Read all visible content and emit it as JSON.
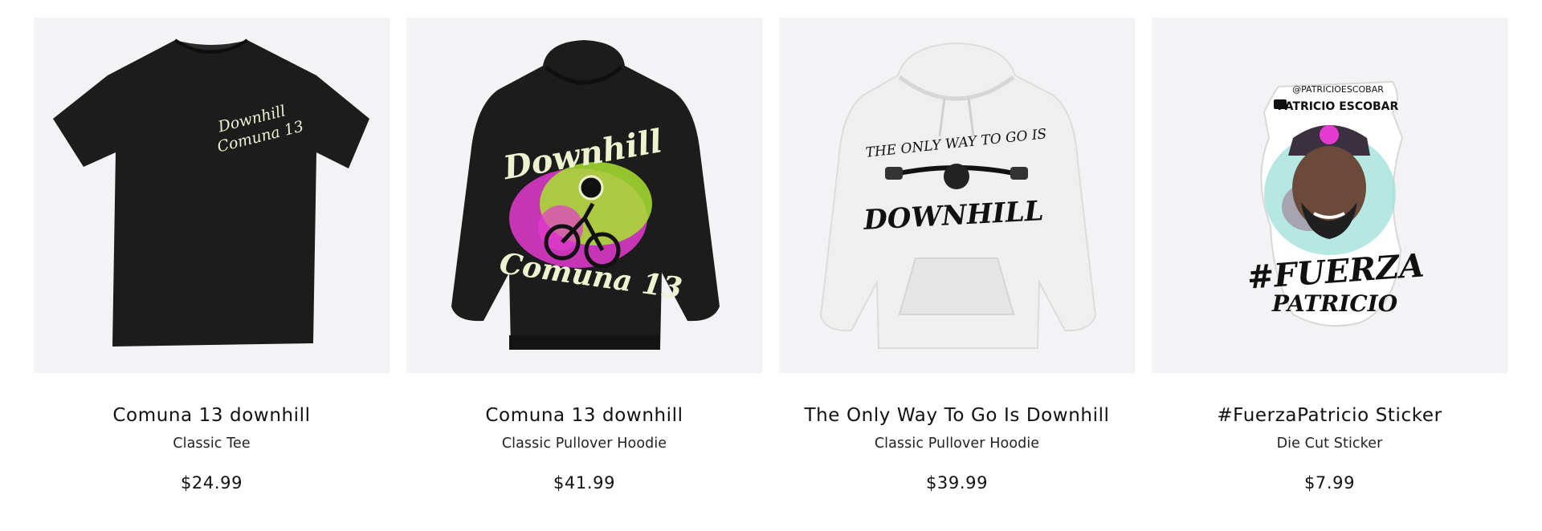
{
  "products": [
    {
      "title": "Comuna 13 downhill",
      "subtitle": "Classic Tee",
      "price": "$24.99",
      "image": "black-tee-with-chest-logo",
      "print_text": [
        "Downhill",
        "Comuna 13"
      ]
    },
    {
      "title": "Comuna 13 downhill",
      "subtitle": "Classic Pullover Hoodie",
      "price": "$41.99",
      "image": "black-hoodie-with-mtb-rider-graphic",
      "print_text": [
        "Downhill",
        "Comuna 13"
      ]
    },
    {
      "title": "The Only Way To Go Is Downhill",
      "subtitle": "Classic Pullover Hoodie",
      "price": "$39.99",
      "image": "white-hoodie-with-handlebar-graphic",
      "print_text": [
        "THE ONLY WAY TO GO IS",
        "DOWNHILL"
      ]
    },
    {
      "title": "#FuerzaPatricio Sticker",
      "subtitle": "Die Cut Sticker",
      "price": "$7.99",
      "image": "die-cut-portrait-sticker",
      "print_text": [
        "@PATRICIOESCOBAR",
        "PATRICIO ESCOBAR",
        "#FUERZA",
        "PATRICIO"
      ]
    }
  ],
  "colors": {
    "image_background": "#f3f3f6",
    "garment_black": "#1c1c1c",
    "garment_white": "#efefef",
    "print_cream": "#eef2cf",
    "neon_green": "#a8e22e",
    "neon_pink": "#e43ad0"
  }
}
